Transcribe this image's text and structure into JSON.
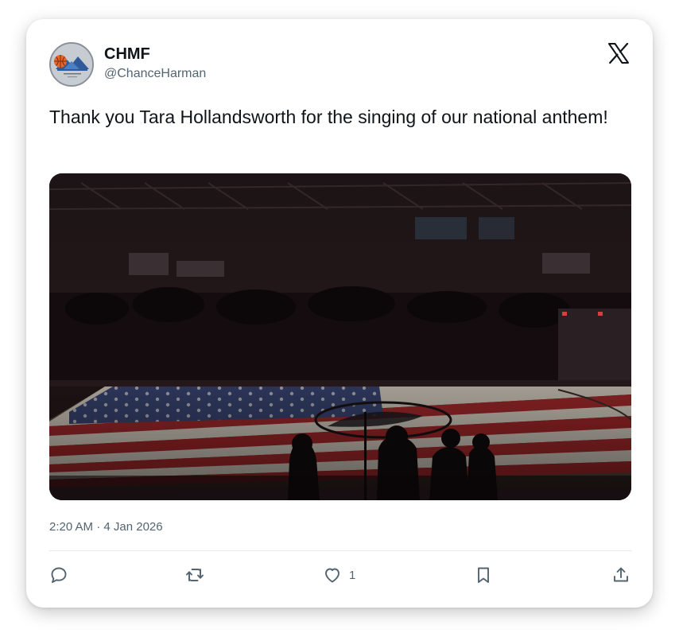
{
  "author": {
    "display_name": "CHMF",
    "handle": "@ChanceHarman",
    "avatar_icon": "basketball-mountain-logo"
  },
  "tweet": {
    "text": "Thank you Tara Hollandsworth for the singing of our national anthem!",
    "timestamp": "2:20 AM · 4 Jan 2026",
    "media_description_icon": "photo"
  },
  "actions": {
    "reply_icon": "reply-icon",
    "retweet_icon": "retweet-icon",
    "like_icon": "heart-icon",
    "like_count": "1",
    "bookmark_icon": "bookmark-icon",
    "share_icon": "share-icon"
  },
  "colors": {
    "text_primary": "#0f1419",
    "text_secondary": "#536471",
    "divider": "#e6e8eb"
  }
}
